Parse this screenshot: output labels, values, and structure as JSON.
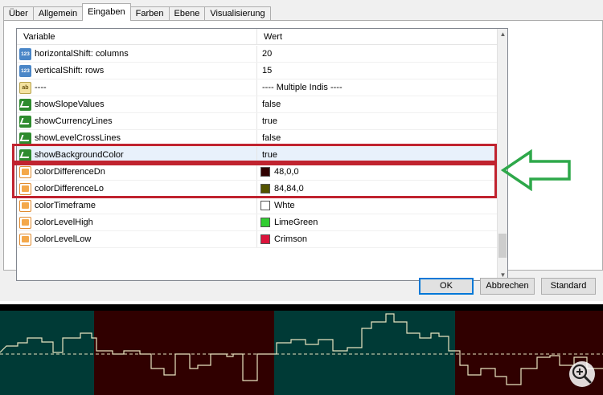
{
  "tabs": [
    "Über",
    "Allgemein",
    "Eingaben",
    "Farben",
    "Ebene",
    "Visualisierung"
  ],
  "active_tab": "Eingaben",
  "grid": {
    "col_variable": "Variable",
    "col_value": "Wert",
    "rows": [
      {
        "name": "horizontalShift: columns",
        "value": "20",
        "icon": "integer-icon",
        "badge": "123"
      },
      {
        "name": "verticalShift: rows",
        "value": "15",
        "icon": "integer-icon",
        "badge": "123"
      },
      {
        "name": "----",
        "value": "---- Multiple Indis ----",
        "icon": "string-icon",
        "badge": "ab"
      },
      {
        "name": "showSlopeValues",
        "value": "false",
        "icon": "boolean-icon"
      },
      {
        "name": "showCurrencyLines",
        "value": "true",
        "icon": "boolean-icon"
      },
      {
        "name": "showLevelCrossLines",
        "value": "false",
        "icon": "boolean-icon"
      },
      {
        "name": "showBackgroundColor",
        "value": "true",
        "icon": "boolean-icon",
        "selected": true
      },
      {
        "name": "colorDifferenceDn",
        "value": "48,0,0",
        "icon": "color-icon",
        "swatch": "#300000"
      },
      {
        "name": "colorDifferenceLo",
        "value": "84,84,0",
        "icon": "color-icon",
        "swatch": "#545400"
      },
      {
        "name": "colorTimeframe",
        "value": "Whte",
        "icon": "color-icon",
        "swatch": "#ffffff"
      },
      {
        "name": "colorLevelHigh",
        "value": "LimeGreen",
        "icon": "color-icon",
        "swatch": "#32cd32"
      },
      {
        "name": "colorLevelLow",
        "value": "Crimson",
        "icon": "color-icon",
        "swatch": "#dc143c"
      }
    ]
  },
  "buttons": {
    "ok": "OK",
    "reset": "Abbrechen",
    "default": "Standard"
  },
  "colors": {
    "highlight_box": "#c0232f",
    "arrow": "#2ea84a",
    "chart_teal": "#003a36",
    "chart_maroon": "#300000",
    "chart_line": "#e8e4c0"
  },
  "chart_icon": "zoom-in-icon"
}
